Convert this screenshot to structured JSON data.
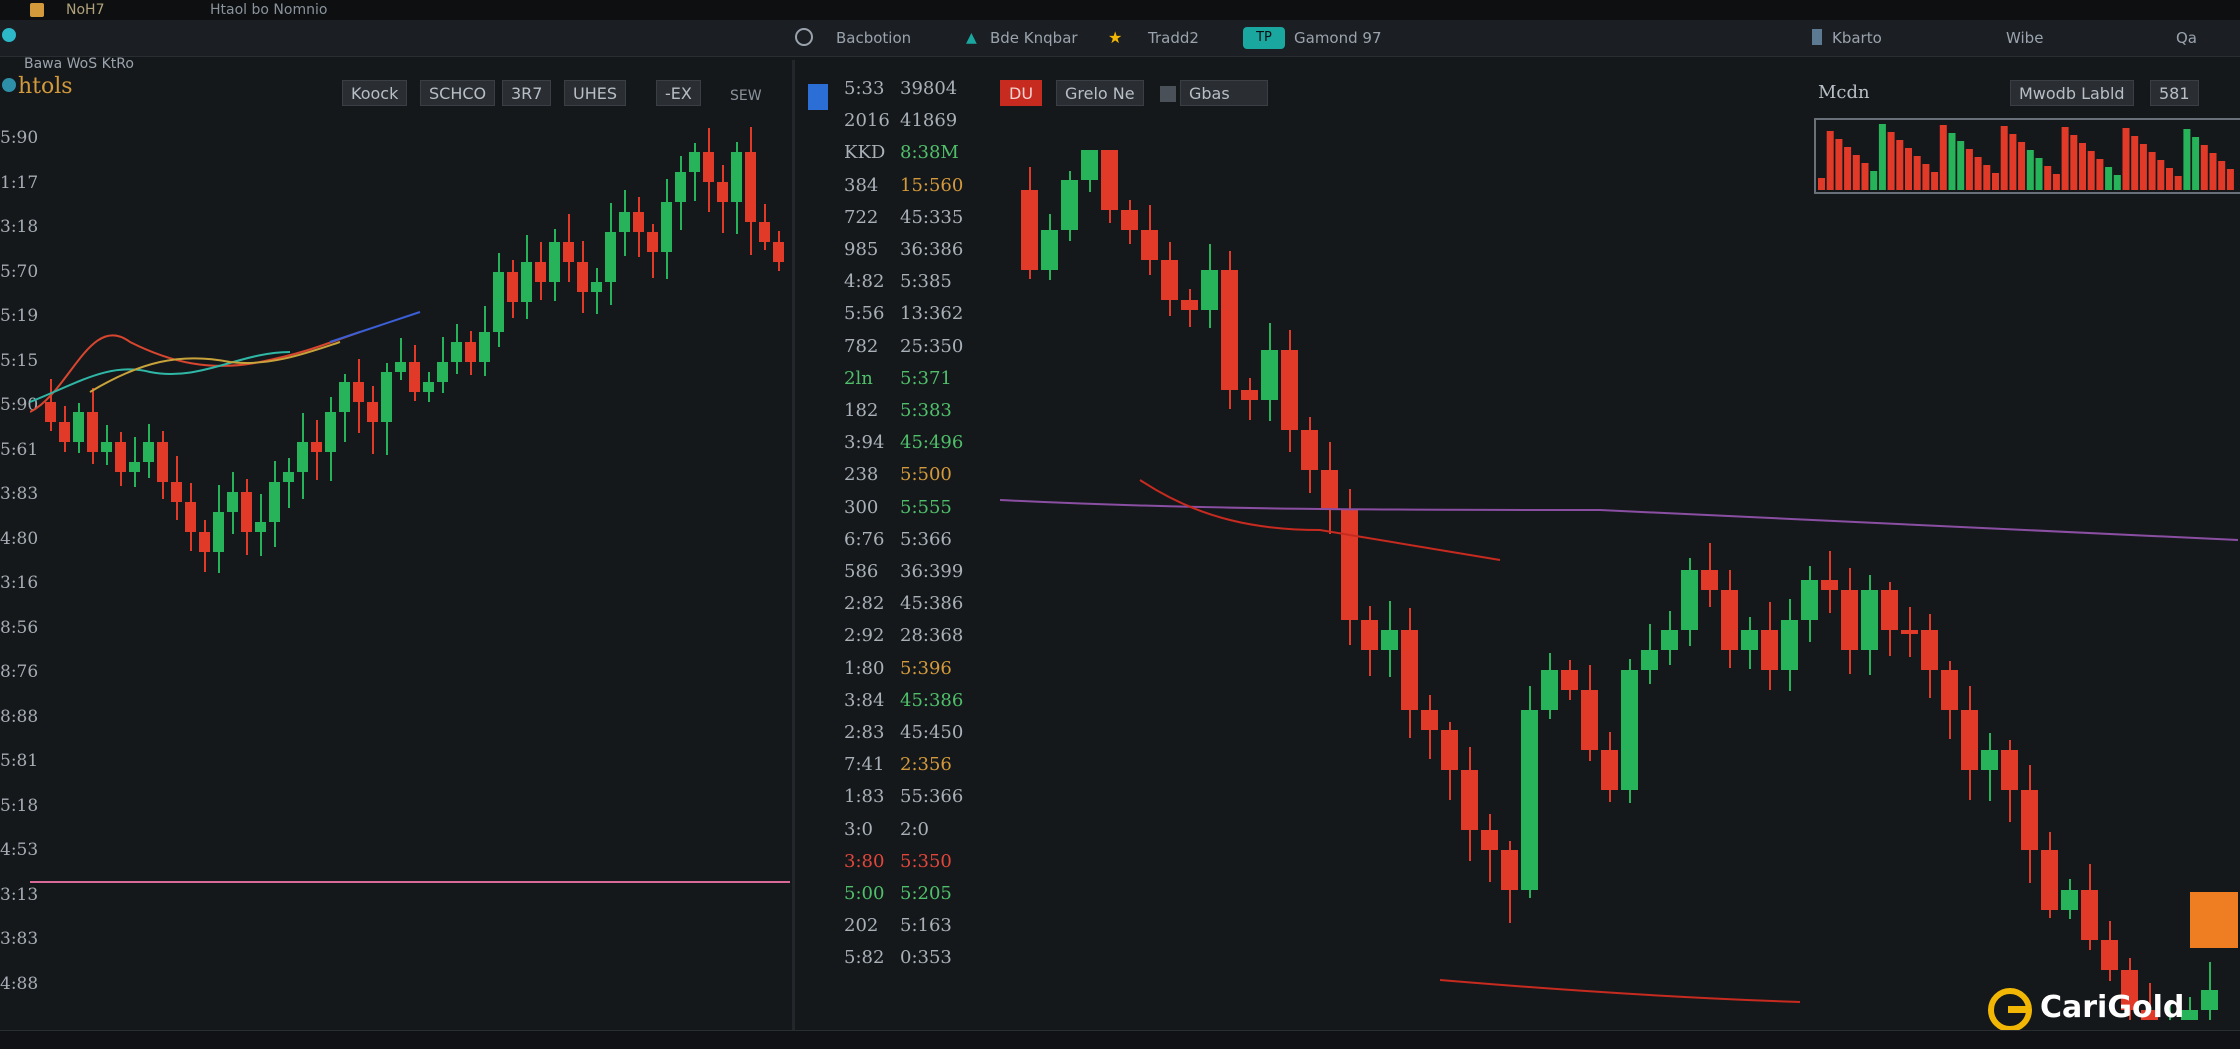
{
  "colors": {
    "up": "#27b35a",
    "down": "#e23a28",
    "bg": "#15181b",
    "accent": "#1aa7a0",
    "brand_gold": "#f2b705"
  },
  "top_bar": {
    "title": "NoH7",
    "subtitle": "Htaol bo Nomnio"
  },
  "toolbar": {
    "left_label": "Bawa WoS KtRo",
    "items": [
      {
        "icon": "search-icon",
        "label": "Bacbotion"
      },
      {
        "icon": "chevron-icon",
        "label": "Bde Knqbar"
      },
      {
        "icon": "star-icon",
        "label": "Tradd2"
      },
      {
        "icon": "tp-icon",
        "label": "Gamond 97"
      },
      {
        "icon": "user-icon",
        "label": "Kbarto"
      },
      {
        "icon": "list-icon",
        "label": "Wibe"
      },
      {
        "icon": "chart-icon",
        "label": "Qa"
      }
    ]
  },
  "left_chart": {
    "symbol": "htols",
    "buttons": [
      "Koock",
      "SCHCO",
      "3R7",
      "UHES",
      "-EX"
    ],
    "right_tag": "SEW",
    "axis_ticks": [
      "5:90",
      "1:17",
      "3:18",
      "5:70",
      "5:19",
      "5:15",
      "5:90",
      "5:61",
      "3:83",
      "4:80",
      "3:16",
      "8:56",
      "8:76",
      "8:88",
      "5:81",
      "5:18",
      "4:53",
      "3:13",
      "3:83",
      "4:88"
    ]
  },
  "order_book": {
    "rows": [
      {
        "a": "5:33",
        "b": "39804"
      },
      {
        "a": "2016",
        "b": "41869"
      },
      {
        "a": "KKD",
        "b": "8:38M"
      },
      {
        "a": "384",
        "b": "15:560"
      },
      {
        "a": "722",
        "b": "45:335"
      },
      {
        "a": "985",
        "b": "36:386"
      },
      {
        "a": "4:82",
        "b": "5:385"
      },
      {
        "a": "5:56",
        "b": "13:362"
      },
      {
        "a": "782",
        "b": "25:350"
      },
      {
        "a": "2ln",
        "b": "5:371"
      },
      {
        "a": "182",
        "b": "5:383"
      },
      {
        "a": "3:94",
        "b": "45:496"
      },
      {
        "a": "238",
        "b": "5:500"
      },
      {
        "a": "300",
        "b": "5:555"
      },
      {
        "a": "6:76",
        "b": "5:366"
      },
      {
        "a": "586",
        "b": "36:399"
      },
      {
        "a": "2:82",
        "b": "45:386"
      },
      {
        "a": "2:92",
        "b": "28:368"
      },
      {
        "a": "1:80",
        "b": "5:396"
      },
      {
        "a": "3:84",
        "b": "45:386"
      },
      {
        "a": "2:83",
        "b": "45:450"
      },
      {
        "a": "7:41",
        "b": "2:356"
      },
      {
        "a": "1:83",
        "b": "55:366"
      },
      {
        "a": "3:0",
        "b": "2:0"
      },
      {
        "a": "3:80",
        "b": "5:350"
      },
      {
        "a": "5:00",
        "b": "5:205"
      },
      {
        "a": "202",
        "b": "5:163"
      },
      {
        "a": "5:82",
        "b": "0:353"
      }
    ]
  },
  "right_chart": {
    "tag": "DU",
    "buttons": [
      "Grelo Ne",
      "Gbas"
    ],
    "mini_title": "Mcdn",
    "mini_buttons": [
      "Mwodb Labld",
      "581"
    ]
  },
  "brand": {
    "name": "CariGold"
  }
}
